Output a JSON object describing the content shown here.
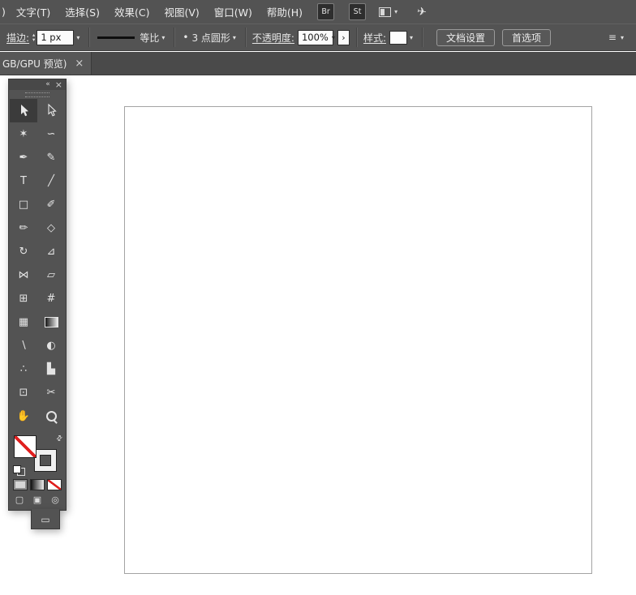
{
  "icons": {
    "dropdown": "▾",
    "step_up": "▴",
    "step_down": "▾",
    "collapse": "«",
    "close": "×",
    "swap": "⇄",
    "panel_menu": "≡",
    "more_chevron": "›",
    "bullet": "•",
    "rocket": "✈"
  },
  "menu_bar": {
    "partial_left": ")",
    "items": [
      "文字(T)",
      "选择(S)",
      "效果(C)",
      "视图(V)",
      "窗口(W)",
      "帮助(H)"
    ],
    "bridge_badge": "Br",
    "stock_badge": "St"
  },
  "control_bar": {
    "stroke_label": "描边:",
    "stroke_value": "1 px",
    "profile_label": "等比",
    "brush_name": "3 点圆形",
    "opacity_label": "不透明度:",
    "opacity_value": "100%",
    "style_label": "样式:",
    "doc_setup_button": "文档设置",
    "preferences_button": "首选项"
  },
  "tab_bar": {
    "title": "GB/GPU 预览)",
    "close": "×"
  },
  "tools_panel": {
    "tools": [
      {
        "name": "selection-tool",
        "icon": "selection-cursor-icon",
        "selected": true
      },
      {
        "name": "direct-selection-tool",
        "icon": "direct-selection-cursor-icon",
        "selected": false
      },
      {
        "name": "magic-wand-tool",
        "glyph": "✶"
      },
      {
        "name": "lasso-tool",
        "glyph": "∽"
      },
      {
        "name": "pen-tool",
        "glyph": "✒"
      },
      {
        "name": "curvature-tool",
        "glyph": "✎"
      },
      {
        "name": "type-tool",
        "glyph": "T"
      },
      {
        "name": "line-segment-tool",
        "glyph": "╱"
      },
      {
        "name": "rectangle-tool",
        "glyph": "□"
      },
      {
        "name": "paintbrush-tool",
        "glyph": "✐"
      },
      {
        "name": "pencil-tool",
        "glyph": "✏"
      },
      {
        "name": "eraser-tool",
        "glyph": "◇"
      },
      {
        "name": "rotate-tool",
        "glyph": "↻"
      },
      {
        "name": "scale-tool",
        "glyph": "⊿"
      },
      {
        "name": "width-tool",
        "glyph": "⋈"
      },
      {
        "name": "free-transform-tool",
        "glyph": "▱"
      },
      {
        "name": "shape-builder-tool",
        "glyph": "⊞"
      },
      {
        "name": "perspective-grid-tool",
        "glyph": "#"
      },
      {
        "name": "mesh-tool",
        "glyph": "▦"
      },
      {
        "name": "gradient-tool",
        "icon": "gradient-swatch-icon",
        "glyph": ""
      },
      {
        "name": "eyedropper-tool",
        "glyph": "∖"
      },
      {
        "name": "blend-tool",
        "glyph": "◐"
      },
      {
        "name": "symbol-sprayer-tool",
        "glyph": "∴"
      },
      {
        "name": "column-graph-tool",
        "glyph": "▙"
      },
      {
        "name": "artboard-tool",
        "glyph": "⊡"
      },
      {
        "name": "slice-tool",
        "glyph": "✂"
      },
      {
        "name": "hand-tool",
        "glyph": "✋"
      },
      {
        "name": "zoom-tool",
        "icon": "magnifier-icon",
        "glyph": ""
      }
    ],
    "drawing_modes": [
      "▢",
      "▣",
      "◎"
    ],
    "screen_mode_glyph": "▭",
    "none_color": "#e0201f"
  }
}
